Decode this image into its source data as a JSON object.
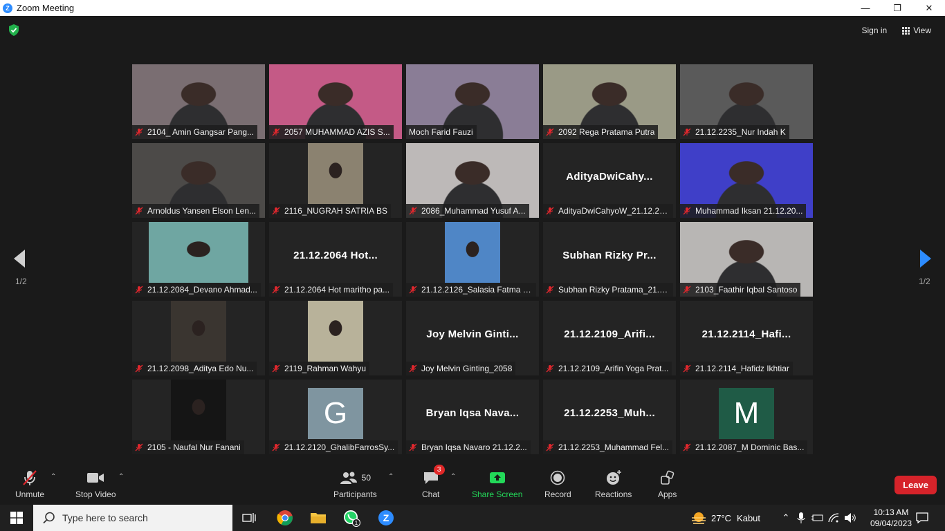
{
  "window": {
    "title": "Zoom Meeting"
  },
  "header": {
    "sign_in": "Sign in",
    "view": "View"
  },
  "navigation": {
    "page_left": "1/2",
    "page_right": "1/2"
  },
  "tiles": [
    {
      "name": "2104_ Amin Gangsar Pang...",
      "bg": "#7a6e72",
      "video": true
    },
    {
      "name": "2057 MUHAMMAD AZIS S...",
      "bg": "#c45a86",
      "video": true
    },
    {
      "name": "Moch Farid Fauzi",
      "bg": "#8a7d96",
      "video": true,
      "active": true
    },
    {
      "name": "2092 Rega Pratama Putra",
      "bg": "#9a9a86",
      "video": true
    },
    {
      "name": "21.12.2235_Nur Indah K",
      "bg": "#5a5a5a",
      "video": true
    },
    {
      "name": "Arnoldus Yansen Elson Len...",
      "bg": "#4c4a48",
      "video": true
    },
    {
      "name": "2116_NUGRAH SATRIA BS",
      "bg": "#242424",
      "video": true,
      "small": true,
      "smallbg": "#8b8270"
    },
    {
      "name": "2086_Muhammad Yusuf A...",
      "bg": "#bdb9b8",
      "video": true
    },
    {
      "name": "AdityaDwiCahyoW_21.12.21...",
      "center": "AdityaDwiCahy..."
    },
    {
      "name": "Muhammad Iksan 21.12.20...",
      "bg": "#3f3fc8",
      "video": true
    },
    {
      "name": "21.12.2084_Devano Ahmad...",
      "bg": "#242424",
      "video": true,
      "small": true,
      "smallbg": "#6fa6a2",
      "smallwide": true
    },
    {
      "name": "21.12.2064 Hot maritho pa...",
      "center": "21.12.2064 Hot..."
    },
    {
      "name": "21.12.2126_Salasia Fatma S...",
      "bg": "#242424",
      "video": true,
      "small": true,
      "smallbg": "#4f86c6"
    },
    {
      "name": "Subhan Rizky Pratama_21.1...",
      "center": "Subhan Rizky Pr..."
    },
    {
      "name": "2103_Faathir Iqbal Santoso",
      "bg": "#b8b6b4",
      "video": true
    },
    {
      "name": "21.12.2098_Aditya Edo Nu...",
      "bg": "#242424",
      "video": true,
      "small": true,
      "smallbg": "#3a3530"
    },
    {
      "name": "2119_Rahman Wahyu",
      "bg": "#242424",
      "video": true,
      "small": true,
      "smallbg": "#b8b29a"
    },
    {
      "name": "Joy Melvin Ginting_2058",
      "center": "Joy Melvin Ginti..."
    },
    {
      "name": "21.12.2109_Arifin Yoga Prat...",
      "center": "21.12.2109_Arifi..."
    },
    {
      "name": "21.12.2114_Hafidz Ikhtiar",
      "center": "21.12.2114_Hafi..."
    },
    {
      "name": "2105 - Naufal Nur Fanani",
      "bg": "#242424",
      "video": true,
      "small": true,
      "smallbg": "#151515"
    },
    {
      "name": "21.12.2120_GhalibFarrosSy...",
      "avatar": "G",
      "avatarbg": "#7f95a0"
    },
    {
      "name": "Bryan Iqsa Navaro 21.12.2...",
      "center": "Bryan Iqsa Nava..."
    },
    {
      "name": "21.12.2253_Muhammad Fel...",
      "center": "21.12.2253_Muh..."
    },
    {
      "name": "21.12.2087_M Dominic Bas...",
      "avatar": "M",
      "avatarbg": "#1f5b46"
    }
  ],
  "toolbar": {
    "unmute": "Unmute",
    "stop_video": "Stop Video",
    "participants": "Participants",
    "participants_count": "50",
    "chat": "Chat",
    "chat_badge": "3",
    "share_screen": "Share Screen",
    "record": "Record",
    "reactions": "Reactions",
    "apps": "Apps",
    "leave": "Leave"
  },
  "taskbar": {
    "search_placeholder": "Type here to search",
    "whatsapp_badge": "1",
    "weather_temp": "27°C",
    "weather_text": "Kabut",
    "time": "10:13 AM",
    "date": "09/04/2023"
  },
  "colors": {
    "accent": "#2d8cff",
    "leave": "#d6232a",
    "share": "#23d959",
    "active_speaker": "#d9e85a"
  }
}
